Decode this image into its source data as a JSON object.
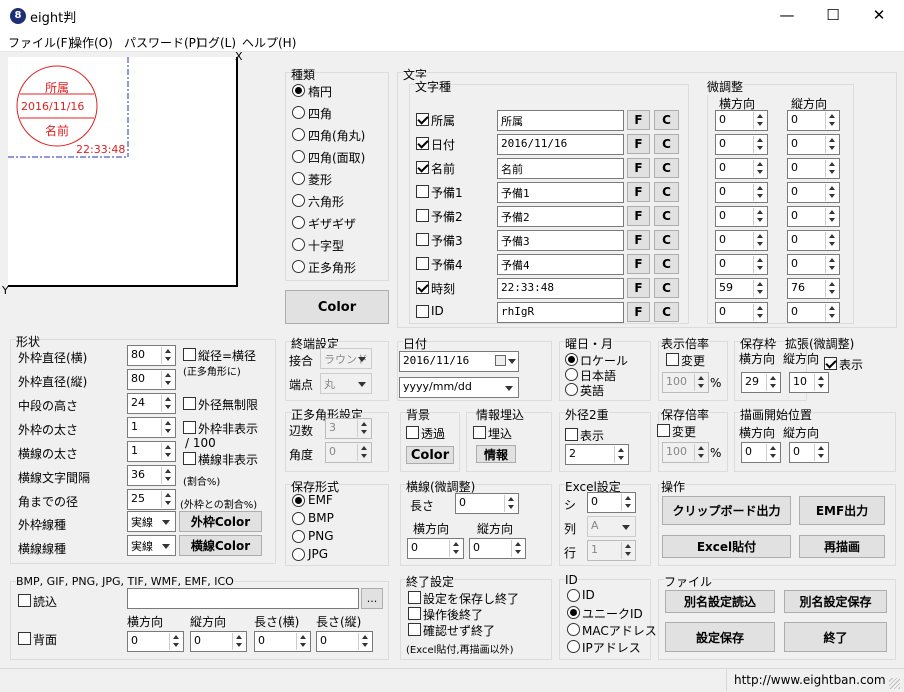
{
  "window": {
    "title": "eight判",
    "app_icon": "8",
    "min": "—",
    "max": "☐",
    "close": "✕"
  },
  "menu": [
    "ファイル(F)",
    "操作(O)",
    "パスワード(P)",
    "ログ(L)",
    "ヘルプ(H)"
  ],
  "preview": {
    "x_label": "X",
    "y_label": "Y",
    "stamp_top": "所属",
    "stamp_mid": "2016/11/16",
    "stamp_bottom": "名前",
    "stamp_time": "22:33:48",
    "stamp_color": "#e02020"
  },
  "shape_type": {
    "title": "種類",
    "items": [
      "楕円",
      "四角",
      "四角(角丸)",
      "四角(面取)",
      "菱形",
      "六角形",
      "ギザギザ",
      "十字型",
      "正多角形"
    ],
    "selected": 0
  },
  "color_button": "Color",
  "text_group": {
    "title": "文字",
    "sub": "文字種",
    "rows": [
      {
        "label": "所属",
        "checked": true,
        "value": "所属",
        "h": "0",
        "v": "0"
      },
      {
        "label": "日付",
        "checked": true,
        "value": "2016/11/16",
        "h": "0",
        "v": "0"
      },
      {
        "label": "名前",
        "checked": true,
        "value": "名前",
        "h": "0",
        "v": "0"
      },
      {
        "label": "予備1",
        "checked": false,
        "value": "予備1",
        "h": "0",
        "v": "0"
      },
      {
        "label": "予備2",
        "checked": false,
        "value": "予備2",
        "h": "0",
        "v": "0"
      },
      {
        "label": "予備3",
        "checked": false,
        "value": "予備3",
        "h": "0",
        "v": "0"
      },
      {
        "label": "予備4",
        "checked": false,
        "value": "予備4",
        "h": "0",
        "v": "0"
      },
      {
        "label": "時刻",
        "checked": true,
        "value": "22:33:48",
        "h": "59",
        "v": "76"
      },
      {
        "label": "ID",
        "checked": false,
        "value": "rhIgR",
        "h": "0",
        "v": "0"
      }
    ],
    "f": "F",
    "c": "C",
    "fine": "微調整",
    "h_dir": "横方向",
    "v_dir": "縦方向"
  },
  "shape": {
    "title": "形状",
    "rows": [
      {
        "label": "外枠直径(横)",
        "value": "80"
      },
      {
        "label": "外枠直径(縦)",
        "value": "80"
      },
      {
        "label": "中段の高さ",
        "value": "24"
      },
      {
        "label": "外枠の太さ",
        "value": "1"
      },
      {
        "label": "横線の太さ",
        "value": "1"
      },
      {
        "label": "横線文字間隔",
        "value": "36"
      },
      {
        "label": "角までの径",
        "value": "25"
      }
    ],
    "eq": "縦径=横径",
    "eq_note": "(正多角形に)",
    "unlimited": "外径無制限",
    "hide_outer": "外枠非表示",
    "per100": "/ 100",
    "hide_line": "横線非表示",
    "ratio": "(割合%)",
    "corner_note": "(外枠との割合%)",
    "outer_type_label": "外枠線種",
    "outer_type": "実線",
    "outer_color": "外枠Color",
    "line_type_label": "横線線種",
    "line_type": "実線",
    "line_color": "横線Color"
  },
  "end": {
    "title": "終端設定",
    "join": "接合",
    "join_val": "ラウンド",
    "cap": "端点",
    "cap_val": "丸"
  },
  "date": {
    "title": "日付",
    "value": "2016/11/16",
    "format": "yyyy/mm/dd"
  },
  "weekday": {
    "title": "曜日・月",
    "items": [
      "ロケール",
      "日本語",
      "英語"
    ],
    "selected": 0
  },
  "ratio": {
    "title": "表示倍率",
    "change": "変更",
    "value": "100",
    "pct": "%"
  },
  "save_frame": {
    "title": "保存枠",
    "h": "横方向",
    "v": "縦方向",
    "hv": "29",
    "vv": "10"
  },
  "expand": {
    "title": "拡張(微調整)",
    "show": "表示"
  },
  "poly": {
    "title": "正多角形設定",
    "sides": "辺数",
    "sides_v": "3",
    "angle": "角度",
    "angle_v": "0"
  },
  "bg": {
    "title": "背景",
    "trans": "透過",
    "color": "Color"
  },
  "info": {
    "title": "情報埋込",
    "embed": "埋込",
    "btn": "情報"
  },
  "outer2": {
    "title": "外径2重",
    "show": "表示",
    "value": "2"
  },
  "save_ratio": {
    "title": "保存倍率",
    "change": "変更",
    "value": "100",
    "pct": "%"
  },
  "draw_start": {
    "title": "描画開始位置",
    "h": "横方向",
    "v": "縦方向",
    "hv": "0",
    "vv": "0"
  },
  "save_fmt": {
    "title": "保存形式",
    "items": [
      "EMF",
      "BMP",
      "PNG",
      "JPG"
    ],
    "selected": 0
  },
  "hline": {
    "title": "横線(微調整)",
    "len": "長さ",
    "len_v": "0",
    "h": "横方向",
    "v": "縦方向",
    "hv": "0",
    "vv": "0"
  },
  "excel": {
    "title": "Excel設定",
    "sheet": "シ",
    "sheet_v": "0",
    "col": "列",
    "col_v": "A",
    "row": "行",
    "row_v": "1"
  },
  "ops": {
    "title": "操作",
    "clip": "クリップボード出力",
    "emf": "EMF出力",
    "excel": "Excel貼付",
    "redraw": "再描画"
  },
  "image": {
    "title": "BMP, GIF, PNG, JPG, TIF, WMF, EMF, ICO",
    "read": "読込",
    "browse": "...",
    "bg": "背面",
    "h": "横方向",
    "v": "縦方向",
    "lh": "長さ(横)",
    "lv": "長さ(縦)",
    "hv": "0",
    "vv": "0",
    "lhv": "0",
    "lvv": "0"
  },
  "exit": {
    "title": "終了設定",
    "a": "設定を保存し終了",
    "b": "操作後終了",
    "c": "確認せず終了",
    "note": "(Excel貼付,再描画以外)"
  },
  "id": {
    "title": "ID",
    "items": [
      "ID",
      "ユニークID",
      "MACアドレス",
      "IPアドレス"
    ],
    "selected": 1
  },
  "file": {
    "title": "ファイル",
    "load": "別名設定読込",
    "saveas": "別名設定保存",
    "save": "設定保存",
    "quit": "終了"
  },
  "status": {
    "url": "http://www.eightban.com"
  }
}
